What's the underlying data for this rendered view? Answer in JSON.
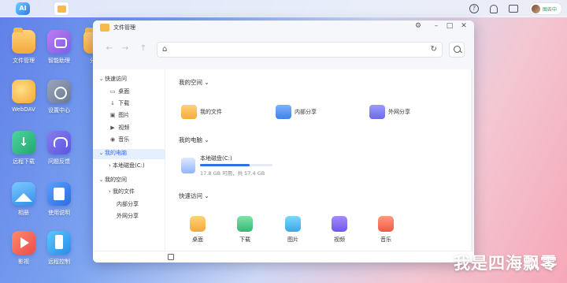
{
  "taskbar": {
    "logo_text": "AI",
    "user_status": "图去中"
  },
  "desktop_icons": [
    {
      "label": "文件管理"
    },
    {
      "label": "智能助理"
    },
    {
      "label": "分享"
    },
    {
      "label": "WebDAV"
    },
    {
      "label": "设置中心"
    },
    {
      "label": "远程下载"
    },
    {
      "label": "问题反馈"
    },
    {
      "label": "相册"
    },
    {
      "label": "使用说明"
    },
    {
      "label": "影视"
    },
    {
      "label": "远程控制"
    }
  ],
  "window": {
    "title": "文件管理",
    "sidebar": {
      "quick_access": "快速访问",
      "quick_items": [
        "桌面",
        "下载",
        "图片",
        "视频",
        "音乐"
      ],
      "my_computer": "我的电脑",
      "local_disk": "本地磁盘(C:)",
      "my_space": "我的空间",
      "my_files": "我的文件",
      "lan_share": "内部分享",
      "wan_share": "外网分享"
    },
    "main": {
      "my_space_title": "我的空间",
      "my_space_items": [
        "我的文件",
        "内部分享",
        "外网分享"
      ],
      "my_computer_title": "我的电脑",
      "disk_name": "本地磁盘(C:)",
      "disk_info": "17.8 GB 可用，共 57.4 GB",
      "disk_used_fraction": 0.69,
      "quick_title": "快速访问",
      "quick_items": [
        "桌面",
        "下载",
        "图片",
        "视频",
        "音乐"
      ]
    }
  },
  "watermark": "我是四海飘零"
}
